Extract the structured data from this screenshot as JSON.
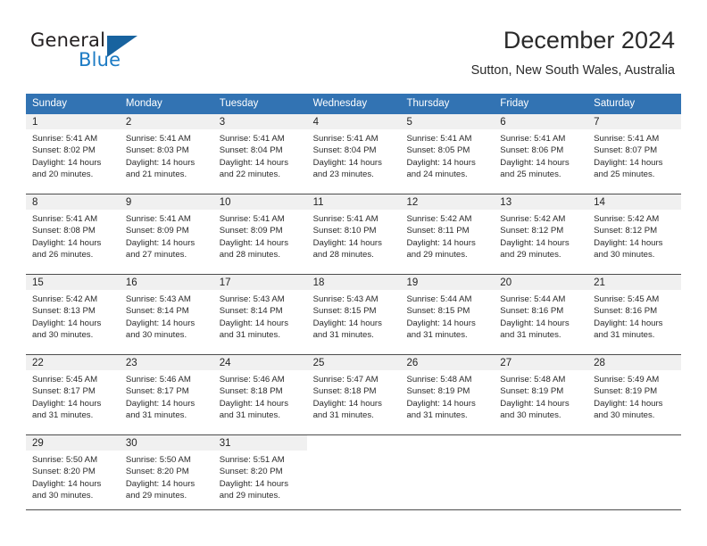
{
  "brand": {
    "name_part1": "General",
    "name_part2": "Blue"
  },
  "header": {
    "title": "December 2024",
    "subtitle": "Sutton, New South Wales, Australia"
  },
  "colors": {
    "header_blue": "#3273b3",
    "brand_blue": "#1c7bc4",
    "triangle_blue": "#18639f",
    "day_band_gray": "#f0f0f0",
    "rule_gray": "#4d4d4d"
  },
  "weekdays": [
    "Sunday",
    "Monday",
    "Tuesday",
    "Wednesday",
    "Thursday",
    "Friday",
    "Saturday"
  ],
  "weeks": [
    [
      {
        "day": "1",
        "sunrise": "Sunrise: 5:41 AM",
        "sunset": "Sunset: 8:02 PM",
        "daylight_line1": "Daylight: 14 hours",
        "daylight_line2": "and 20 minutes."
      },
      {
        "day": "2",
        "sunrise": "Sunrise: 5:41 AM",
        "sunset": "Sunset: 8:03 PM",
        "daylight_line1": "Daylight: 14 hours",
        "daylight_line2": "and 21 minutes."
      },
      {
        "day": "3",
        "sunrise": "Sunrise: 5:41 AM",
        "sunset": "Sunset: 8:04 PM",
        "daylight_line1": "Daylight: 14 hours",
        "daylight_line2": "and 22 minutes."
      },
      {
        "day": "4",
        "sunrise": "Sunrise: 5:41 AM",
        "sunset": "Sunset: 8:04 PM",
        "daylight_line1": "Daylight: 14 hours",
        "daylight_line2": "and 23 minutes."
      },
      {
        "day": "5",
        "sunrise": "Sunrise: 5:41 AM",
        "sunset": "Sunset: 8:05 PM",
        "daylight_line1": "Daylight: 14 hours",
        "daylight_line2": "and 24 minutes."
      },
      {
        "day": "6",
        "sunrise": "Sunrise: 5:41 AM",
        "sunset": "Sunset: 8:06 PM",
        "daylight_line1": "Daylight: 14 hours",
        "daylight_line2": "and 25 minutes."
      },
      {
        "day": "7",
        "sunrise": "Sunrise: 5:41 AM",
        "sunset": "Sunset: 8:07 PM",
        "daylight_line1": "Daylight: 14 hours",
        "daylight_line2": "and 25 minutes."
      }
    ],
    [
      {
        "day": "8",
        "sunrise": "Sunrise: 5:41 AM",
        "sunset": "Sunset: 8:08 PM",
        "daylight_line1": "Daylight: 14 hours",
        "daylight_line2": "and 26 minutes."
      },
      {
        "day": "9",
        "sunrise": "Sunrise: 5:41 AM",
        "sunset": "Sunset: 8:09 PM",
        "daylight_line1": "Daylight: 14 hours",
        "daylight_line2": "and 27 minutes."
      },
      {
        "day": "10",
        "sunrise": "Sunrise: 5:41 AM",
        "sunset": "Sunset: 8:09 PM",
        "daylight_line1": "Daylight: 14 hours",
        "daylight_line2": "and 28 minutes."
      },
      {
        "day": "11",
        "sunrise": "Sunrise: 5:41 AM",
        "sunset": "Sunset: 8:10 PM",
        "daylight_line1": "Daylight: 14 hours",
        "daylight_line2": "and 28 minutes."
      },
      {
        "day": "12",
        "sunrise": "Sunrise: 5:42 AM",
        "sunset": "Sunset: 8:11 PM",
        "daylight_line1": "Daylight: 14 hours",
        "daylight_line2": "and 29 minutes."
      },
      {
        "day": "13",
        "sunrise": "Sunrise: 5:42 AM",
        "sunset": "Sunset: 8:12 PM",
        "daylight_line1": "Daylight: 14 hours",
        "daylight_line2": "and 29 minutes."
      },
      {
        "day": "14",
        "sunrise": "Sunrise: 5:42 AM",
        "sunset": "Sunset: 8:12 PM",
        "daylight_line1": "Daylight: 14 hours",
        "daylight_line2": "and 30 minutes."
      }
    ],
    [
      {
        "day": "15",
        "sunrise": "Sunrise: 5:42 AM",
        "sunset": "Sunset: 8:13 PM",
        "daylight_line1": "Daylight: 14 hours",
        "daylight_line2": "and 30 minutes."
      },
      {
        "day": "16",
        "sunrise": "Sunrise: 5:43 AM",
        "sunset": "Sunset: 8:14 PM",
        "daylight_line1": "Daylight: 14 hours",
        "daylight_line2": "and 30 minutes."
      },
      {
        "day": "17",
        "sunrise": "Sunrise: 5:43 AM",
        "sunset": "Sunset: 8:14 PM",
        "daylight_line1": "Daylight: 14 hours",
        "daylight_line2": "and 31 minutes."
      },
      {
        "day": "18",
        "sunrise": "Sunrise: 5:43 AM",
        "sunset": "Sunset: 8:15 PM",
        "daylight_line1": "Daylight: 14 hours",
        "daylight_line2": "and 31 minutes."
      },
      {
        "day": "19",
        "sunrise": "Sunrise: 5:44 AM",
        "sunset": "Sunset: 8:15 PM",
        "daylight_line1": "Daylight: 14 hours",
        "daylight_line2": "and 31 minutes."
      },
      {
        "day": "20",
        "sunrise": "Sunrise: 5:44 AM",
        "sunset": "Sunset: 8:16 PM",
        "daylight_line1": "Daylight: 14 hours",
        "daylight_line2": "and 31 minutes."
      },
      {
        "day": "21",
        "sunrise": "Sunrise: 5:45 AM",
        "sunset": "Sunset: 8:16 PM",
        "daylight_line1": "Daylight: 14 hours",
        "daylight_line2": "and 31 minutes."
      }
    ],
    [
      {
        "day": "22",
        "sunrise": "Sunrise: 5:45 AM",
        "sunset": "Sunset: 8:17 PM",
        "daylight_line1": "Daylight: 14 hours",
        "daylight_line2": "and 31 minutes."
      },
      {
        "day": "23",
        "sunrise": "Sunrise: 5:46 AM",
        "sunset": "Sunset: 8:17 PM",
        "daylight_line1": "Daylight: 14 hours",
        "daylight_line2": "and 31 minutes."
      },
      {
        "day": "24",
        "sunrise": "Sunrise: 5:46 AM",
        "sunset": "Sunset: 8:18 PM",
        "daylight_line1": "Daylight: 14 hours",
        "daylight_line2": "and 31 minutes."
      },
      {
        "day": "25",
        "sunrise": "Sunrise: 5:47 AM",
        "sunset": "Sunset: 8:18 PM",
        "daylight_line1": "Daylight: 14 hours",
        "daylight_line2": "and 31 minutes."
      },
      {
        "day": "26",
        "sunrise": "Sunrise: 5:48 AM",
        "sunset": "Sunset: 8:19 PM",
        "daylight_line1": "Daylight: 14 hours",
        "daylight_line2": "and 31 minutes."
      },
      {
        "day": "27",
        "sunrise": "Sunrise: 5:48 AM",
        "sunset": "Sunset: 8:19 PM",
        "daylight_line1": "Daylight: 14 hours",
        "daylight_line2": "and 30 minutes."
      },
      {
        "day": "28",
        "sunrise": "Sunrise: 5:49 AM",
        "sunset": "Sunset: 8:19 PM",
        "daylight_line1": "Daylight: 14 hours",
        "daylight_line2": "and 30 minutes."
      }
    ],
    [
      {
        "day": "29",
        "sunrise": "Sunrise: 5:50 AM",
        "sunset": "Sunset: 8:20 PM",
        "daylight_line1": "Daylight: 14 hours",
        "daylight_line2": "and 30 minutes."
      },
      {
        "day": "30",
        "sunrise": "Sunrise: 5:50 AM",
        "sunset": "Sunset: 8:20 PM",
        "daylight_line1": "Daylight: 14 hours",
        "daylight_line2": "and 29 minutes."
      },
      {
        "day": "31",
        "sunrise": "Sunrise: 5:51 AM",
        "sunset": "Sunset: 8:20 PM",
        "daylight_line1": "Daylight: 14 hours",
        "daylight_line2": "and 29 minutes."
      },
      {
        "day": "",
        "sunrise": "",
        "sunset": "",
        "daylight_line1": "",
        "daylight_line2": ""
      },
      {
        "day": "",
        "sunrise": "",
        "sunset": "",
        "daylight_line1": "",
        "daylight_line2": ""
      },
      {
        "day": "",
        "sunrise": "",
        "sunset": "",
        "daylight_line1": "",
        "daylight_line2": ""
      },
      {
        "day": "",
        "sunrise": "",
        "sunset": "",
        "daylight_line1": "",
        "daylight_line2": ""
      }
    ]
  ]
}
